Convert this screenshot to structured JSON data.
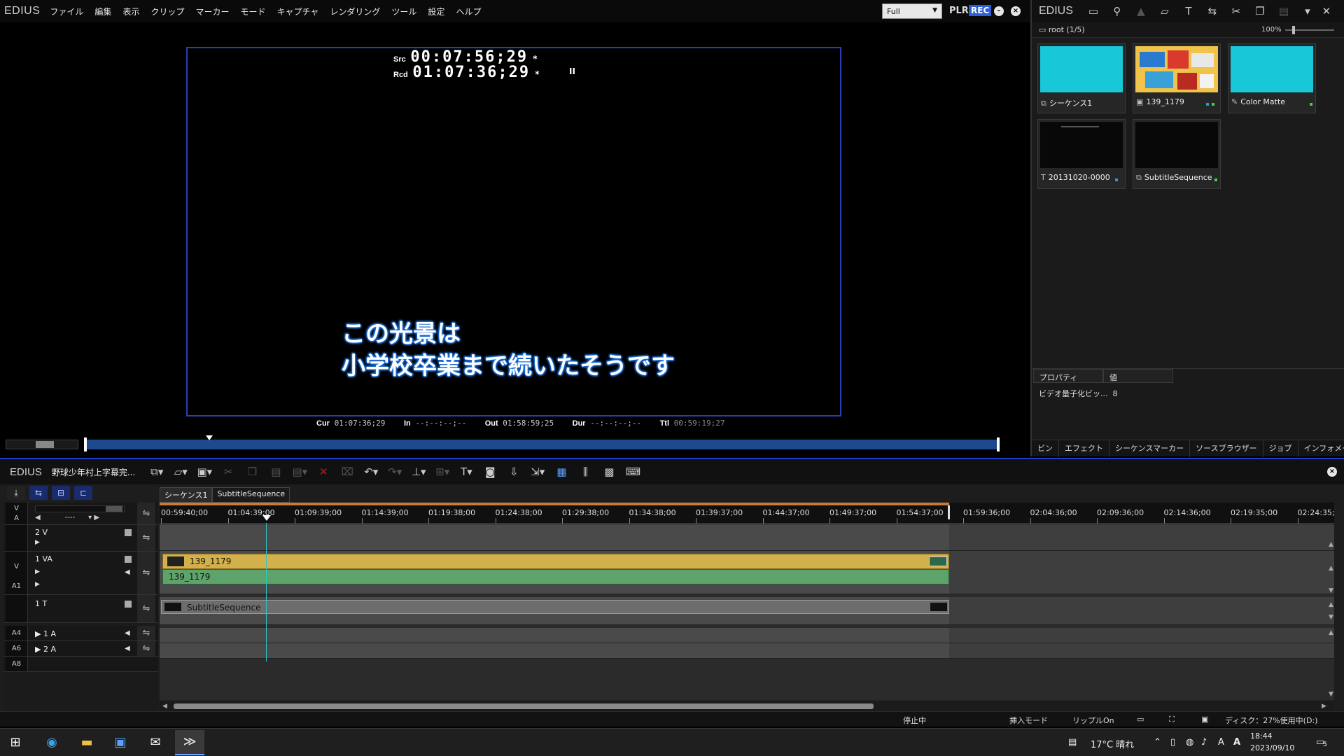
{
  "app": {
    "logo": "EDIUS",
    "menus": [
      "ファイル",
      "編集",
      "表示",
      "クリップ",
      "マーカー",
      "モード",
      "キャプチャ",
      "レンダリング",
      "ツール",
      "設定",
      "ヘルプ"
    ]
  },
  "player": {
    "mode": "Full",
    "plr": "PLR",
    "rec": "REC",
    "src_label": "Src",
    "src_tc": "00:07:56;29",
    "rcd_label": "Rcd",
    "rcd_tc": "01:07:36;29",
    "pause_indicator": "II",
    "subtitle_line1": "この光景は",
    "subtitle_line2": "小学校卒業まで続いたそうです",
    "cur_label": "Cur",
    "cur": "01:07:36;29",
    "in_label": "In",
    "in": "--:--:--;--",
    "out_label": "Out",
    "out": "01:58:59;25",
    "dur_label": "Dur",
    "dur": "--:--:--;--",
    "ttl_label": "Ttl",
    "ttl": "00:59:19;27",
    "playhead_fraction": 0.11
  },
  "bin": {
    "logo": "EDIUS",
    "path": "root (1/5)",
    "zoom": "100%",
    "clips": [
      {
        "name": "シーケンス1",
        "icon": "sequence-icon",
        "thumb": "#18c8d8"
      },
      {
        "name": "139_1179",
        "icon": "video-clip-icon",
        "thumb": "image"
      },
      {
        "name": "Color Matte",
        "icon": "color-matte-icon",
        "thumb": "#18c8d8"
      },
      {
        "name": "20131020-0000",
        "icon": "title-icon",
        "thumb": "#080808"
      },
      {
        "name": "SubtitleSequence",
        "icon": "sequence-icon",
        "thumb": "#080808"
      }
    ],
    "prop_header": "プロパティ",
    "value_header": "値",
    "prop_row_name": "ビデオ量子化ビッ...",
    "prop_row_value": "8",
    "tabs": [
      "ビン",
      "エフェクト",
      "シーケンスマーカー",
      "ソースブラウザー",
      "ジョブ",
      "インフォメーション"
    ]
  },
  "timeline": {
    "logo": "EDIUS",
    "project": "野球少年村上字幕完...",
    "seq_tabs": [
      "シーケンス1",
      "SubtitleSequence"
    ],
    "ruler_labels": [
      "00:59:40;00",
      "01:04:39;00",
      "01:09:39;00",
      "01:14:39;00",
      "01:19:38;00",
      "01:24:38;00",
      "01:29:38;00",
      "01:34:38;00",
      "01:39:37;00",
      "01:44:37;00",
      "01:49:37;00",
      "01:54:37;00",
      "01:59:36;00",
      "02:04:36;00",
      "02:09:36;00",
      "02:14:36;00",
      "02:19:35;00",
      "02:24:35;"
    ],
    "header_v": "V",
    "header_a": "A",
    "header_dashes": "----",
    "tracks": {
      "t2v": "2 V",
      "t1va": "1 VA",
      "t1t": "1 T",
      "a1": "1 A",
      "a2": "2 A",
      "patch_v": "V",
      "patch_a1": "A1",
      "patch_a4": "A4",
      "patch_a6": "A6",
      "patch_a8": "A8"
    },
    "clip_video": "139_1179",
    "clip_audio": "139_1179",
    "clip_subtitle": "SubtitleSequence"
  },
  "status": {
    "state": "停止中",
    "insert_mode": "挿入モード",
    "ripple": "リップルOn",
    "disk": "ディスク：27%使用中(D:)"
  },
  "taskbar": {
    "weather": "17°C 晴れ",
    "time": "18:44",
    "date": "2023/09/10",
    "notif": "5"
  }
}
